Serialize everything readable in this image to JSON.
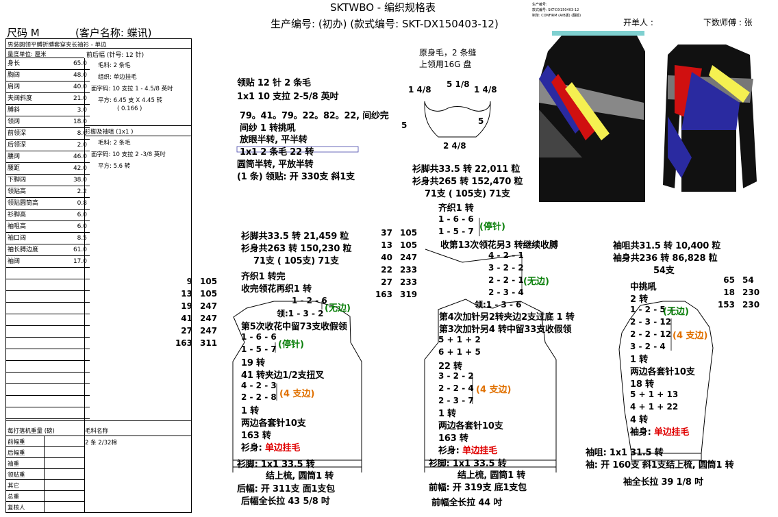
{
  "header": {
    "title": "SKTWBO - 编织规格表",
    "prod_no": "生产编号: (初办) (款式编号: SKT-DX150403-12)",
    "size": "尺码 M",
    "customer": "(客户名称: 蝶讯)",
    "opener": "开单人 :",
    "master": "下数师傅 : 张",
    "tiny_lines": [
      "生产编号:",
      "款式编号: SKT-DX150403-12",
      "制单: CONFIRM (A/B版) (翻版)"
    ]
  },
  "spec": {
    "style_name": "男装圆领平膊折膊套穿夹长袖衫 - 单边",
    "unit": "量度单位: 厘米",
    "rows": [
      {
        "label": "身长",
        "value": "65.0"
      },
      {
        "label": "胸阔",
        "value": "48.0"
      },
      {
        "label": "肩阔",
        "value": "40.0"
      },
      {
        "label": "夹阔斜度",
        "value": "21.0"
      },
      {
        "label": "膊斜",
        "value": "3.0"
      },
      {
        "label": "领阔",
        "value": "18.0"
      },
      {
        "label": "前领深",
        "value": "8.0"
      },
      {
        "label": "后领深",
        "value": "2.0"
      },
      {
        "label": "腰阔",
        "value": "46.0"
      },
      {
        "label": "腰距",
        "value": "42.0"
      },
      {
        "label": "下脚阔",
        "value": "38.0"
      },
      {
        "label": "领贴高",
        "value": "2.2"
      },
      {
        "label": "领贴圆筒高",
        "value": "0.8"
      },
      {
        "label": "衫脚高",
        "value": "6.0"
      },
      {
        "label": "袖咀高",
        "value": "6.0"
      },
      {
        "label": "袖口阔",
        "value": "8.5"
      },
      {
        "label": "袖长膊边度",
        "value": "61.0"
      },
      {
        "label": "袖阔",
        "value": "17.0"
      },
      {
        "label": "",
        "value": ""
      },
      {
        "label": "",
        "value": ""
      },
      {
        "label": "",
        "value": ""
      },
      {
        "label": "",
        "value": ""
      },
      {
        "label": "",
        "value": ""
      },
      {
        "label": "",
        "value": ""
      },
      {
        "label": "",
        "value": ""
      },
      {
        "label": "",
        "value": ""
      },
      {
        "label": "",
        "value": ""
      },
      {
        "label": "",
        "value": ""
      },
      {
        "label": "",
        "value": ""
      },
      {
        "label": "",
        "value": ""
      },
      {
        "label": "",
        "value": ""
      }
    ],
    "right": [
      "前后幅 (针号: 12 针)",
      "毛料: 2 条毛",
      "组织: 单边挂毛",
      "面字码: 10 支拉 1 - 4.5/8 英吋",
      "平方: 6.45 支 X 4.45 转",
      "( 0.166 )",
      "衫脚及袖咀 (1x1 )",
      "毛料: 2 条毛",
      "面字码: 10 支拉 2 -3/8 英吋",
      "平方: 5.6 转"
    ],
    "weight_title": "每打落机重量 (磅)",
    "material_title": "毛料名称",
    "material": "2 条 2/32棉",
    "weights": [
      "前幅重",
      "后幅重",
      "袖重",
      "领贴重",
      "其它",
      "总重",
      "复核人"
    ]
  },
  "collar": {
    "l1": "领贴  12 针 2 条毛",
    "l2": "1x1   10 支拉 2-5/8 英吋",
    "l3": "79。41。79。22。82。22, 间纱完",
    "l4": "间纱 1 转挑吼",
    "l5": "放眼半转, 平半转",
    "l6": "1x1   2 条毛        22 转",
    "l7": "圆筒半转, 平放半转",
    "l8": "(1 条) 领贴: 开 330支 斜1支"
  },
  "neck": {
    "desc1": "原身毛，2 条缝",
    "desc2": "上领用16G 盘",
    "left": "1 4/8",
    "top": "5 1/8",
    "right": "1 4/8",
    "sideL": "5",
    "sideR": "5",
    "bottom": "2 4/8"
  },
  "back": {
    "sum1": "衫脚共33.5 转 21,459 粒",
    "sum2": "衫身共263 转 150,230 粒",
    "sum3": "71支 ( 105支) 71支",
    "l1": "齐织1 转完",
    "l2": "收完领花再织1 转",
    "n1": "1 - 2 - 6",
    "n1b": "(无边)",
    "n2": "领:1 - 3 - 2",
    "l3": "第5次收花中留73支收假领",
    "s1": "1 - 6 - 6",
    "s2": "1 - 5 - 7",
    "s2b": "(停针)",
    "l4": "19 转",
    "l5": "41 转夹边1/2支扭叉",
    "a1": "4 - 2 - 3",
    "a2": "2 - 2 - 8",
    "a2b": "(4 支边)",
    "l6": "1 转",
    "l7": "两边各套针10支",
    "l8": "163 转",
    "l9": "衫身: ",
    "l9b": "单边挂毛",
    "rib1": "衫脚: 1x1     33.5 转",
    "rib2": "结上梳, 圆筒1 转",
    "l10": "后幅: 开 311支 面1支包",
    "l11": "后幅全长拉 43 5/8 吋",
    "cols": [
      [
        "9",
        "105"
      ],
      [
        "13",
        "105"
      ],
      [
        "19",
        "247"
      ],
      [
        "41",
        "247"
      ],
      [
        "27",
        "247"
      ],
      [
        "163",
        "311"
      ]
    ]
  },
  "front": {
    "sum1": "衫脚共33.5 转 22,011 粒",
    "sum2": "衫身共265 转 152,470 粒",
    "sum3": "71支 ( 105支) 71支",
    "l1": "齐织1 转",
    "f1": "1 - 6 - 6",
    "f2": "1 - 5 - 7",
    "f2b": "(停针)",
    "l2": "收第13次领花另3 转继续收膊",
    "n1": "4 - 2 - 1",
    "n2": "3 - 2 - 2",
    "n3": "2 - 2 - 1",
    "n3b": "(无边)",
    "n4": "2 - 3 - 4",
    "n5": "领:1 - 3 - 6",
    "l3": "第4次加针另2转夹边2支过底 1 转",
    "l4": "第3次加针另4 转中留33支收假领",
    "p1": "5 + 1 + 2",
    "p2": "6 + 1 + 5",
    "l5": "22 转",
    "a1": "3 - 2 - 2",
    "a2": "2 - 2 - 4",
    "a2b": "(4 支边)",
    "a3": "2 - 3 - 7",
    "l6": "1 转",
    "l7": "两边各套针10支",
    "l8": "163 转",
    "l9": "衫身: ",
    "l9b": "单边挂毛",
    "rib1": "衫脚: 1x1     33.5 转",
    "rib2": "结上梳, 圆筒1 转",
    "l10": "前幅: 开 319支 底1支包",
    "l11": "前幅全长拉 44 吋",
    "cols": [
      [
        "37",
        "105"
      ],
      [
        "13",
        "105"
      ],
      [
        "40",
        "247"
      ],
      [
        "22",
        "233"
      ],
      [
        "27",
        "233"
      ],
      [
        "163",
        "319"
      ]
    ]
  },
  "sleeve": {
    "sum1": "袖咀共31.5 转 10,400 粒",
    "sum2": "袖身共236 转 86,828 粒",
    "sum3": "54支",
    "l1": "中挑吼",
    "l2": "2 转",
    "a1": "1 - 2 - 5",
    "a1b": "(无边)",
    "a2": "2 - 3 - 12",
    "a3": "2 - 2 - 12",
    "a3b": "(4 支边)",
    "a4": "3 - 2 - 4",
    "l3": "1 转",
    "l4": "两边各套针10支",
    "l5": "18 转",
    "p1": "5 + 1 + 13",
    "p2": "4 + 1 + 22",
    "l6": "4 转",
    "l7": "袖身: ",
    "l7b": "单边挂毛",
    "rib1": "袖咀: 1x1     31.5 转",
    "rib2": "袖: 开 160支 斜1支结上梳, 圆筒1 转",
    "l8": "袖全长拉 39 1/8 吋",
    "cols": [
      [
        "65",
        "54"
      ],
      [
        "18",
        "230"
      ],
      [
        "153",
        "230"
      ]
    ]
  },
  "colors": {
    "green": "#0a7f0a",
    "orange": "#e07000",
    "red": "#e00000",
    "blue": "#1a4fd6",
    "yellow": "#f5f051"
  }
}
